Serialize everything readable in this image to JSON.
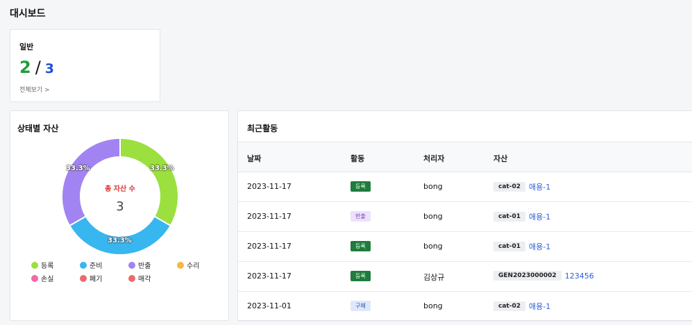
{
  "page": {
    "title": "대시보드"
  },
  "general": {
    "title": "일반",
    "active_count": "2",
    "slash": "/",
    "total_count": "3",
    "view_all": "전체보기 >"
  },
  "status": {
    "title": "상태별 자산",
    "center_label": "총 자산 수",
    "center_value": "3",
    "segments": [
      {
        "label": "등록",
        "percent": "33.3%",
        "value": 1,
        "color": "#9be03f"
      },
      {
        "label": "준비",
        "percent": "33.3%",
        "value": 1,
        "color": "#38b6f0"
      },
      {
        "label": "반출",
        "percent": "33.3%",
        "value": 1,
        "color": "#a184f2"
      }
    ],
    "legend": [
      {
        "label": "등록",
        "color": "#9be03f"
      },
      {
        "label": "준비",
        "color": "#38b6f0"
      },
      {
        "label": "반출",
        "color": "#a184f2"
      },
      {
        "label": "수리",
        "color": "#f6b73c"
      },
      {
        "label": "손실",
        "color": "#f06aa5"
      },
      {
        "label": "폐기",
        "color": "#ee6a6a"
      },
      {
        "label": "매각",
        "color": "#ee6a6a"
      }
    ]
  },
  "activity": {
    "title": "최근활동",
    "columns": [
      "날짜",
      "활동",
      "처리자",
      "자산"
    ],
    "rows": [
      {
        "date": "2023-11-17",
        "action": "등록",
        "action_type": "register",
        "user": "bong",
        "asset_code": "cat-02",
        "asset_name": "애용-1"
      },
      {
        "date": "2023-11-17",
        "action": "반출",
        "action_type": "checkout",
        "user": "bong",
        "asset_code": "cat-01",
        "asset_name": "애용-1"
      },
      {
        "date": "2023-11-17",
        "action": "등록",
        "action_type": "register",
        "user": "bong",
        "asset_code": "cat-01",
        "asset_name": "애용-1"
      },
      {
        "date": "2023-11-17",
        "action": "등록",
        "action_type": "register",
        "user": "김상규",
        "asset_code": "GEN2023000002",
        "asset_name": "123456"
      },
      {
        "date": "2023-11-01",
        "action": "구매",
        "action_type": "purchase",
        "user": "bong",
        "asset_code": "cat-02",
        "asset_name": "애용-1"
      }
    ]
  }
}
